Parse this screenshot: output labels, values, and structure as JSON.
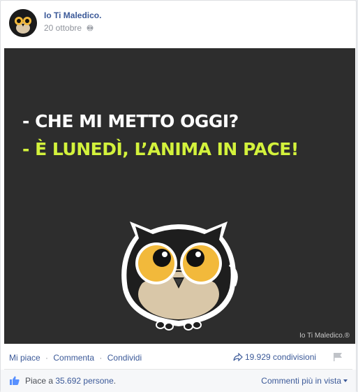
{
  "post": {
    "page_name": "Io Ti Maledico.",
    "date": "20 ottobre",
    "privacy_icon": "globe-icon"
  },
  "image": {
    "caption_line1": "- CHE MI METTO OGGI?",
    "caption_line2": "- È LUNEDÌ, L’ANIMA IN PACE!",
    "watermark": "Io Ti Maledico.®",
    "background_color": "#2d2d2d",
    "accent_color": "#d3f23c"
  },
  "actions": {
    "like": "Mi piace",
    "separator": "·",
    "comment": "Commenta",
    "share": "Condividi",
    "shares_count": "19.929 condivisioni"
  },
  "likes": {
    "prefix": "Piace a",
    "count": "35.692 persone",
    "suffix": ".",
    "sort_label": "Commenti più in vista"
  }
}
